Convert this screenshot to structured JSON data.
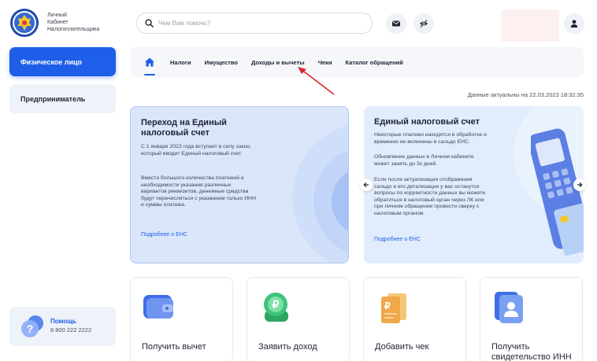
{
  "header": {
    "logo_lines": [
      "Личный",
      "Кабинет",
      "Налогоплательщика"
    ],
    "search_placeholder": "Чем Вам помочь?",
    "icons": [
      "mail-icon",
      "eye-off-icon",
      "user-icon"
    ]
  },
  "sidebar": {
    "items": [
      {
        "label": "Физическое лицо",
        "active": true
      },
      {
        "label": "Предприниматель",
        "active": false
      }
    ],
    "help": {
      "title": "Помощь",
      "phone": "8 800 222 2222"
    }
  },
  "nav": {
    "items": [
      "Налоги",
      "Имущество",
      "Доходы и вычеты",
      "Чеки",
      "Каталог обращений"
    ]
  },
  "updated_text": "Данные актуальны на 22.03.2023 18:32:35",
  "banners": [
    {
      "title": "Переход на Единый налоговый счет",
      "paragraphs": [
        "С 1 января 2023 года вступает в силу закон, который вводит Единый налоговый счет.",
        "Вместо большого количества платежей и необходимости указания различных вариантов реквизитов, денежные средства будут перечисляться с указанием только ИНН и суммы платежа."
      ],
      "link": "Подробнее о ЕНС"
    },
    {
      "title": "Единый налоговый счет",
      "paragraphs": [
        "Некоторые платежи находятся в обработке и временно не включены в сальдо ЕНС.",
        "Обновление данных в Личном кабинете может занять до 3х дней.",
        "Если после актуализации отображения сальдо и его детализации у вас останутся вопросы по корректности данных вы можете обратиться в налоговый орган через ЛК или при личном обращении провести сверку с налоговым органом."
      ],
      "link": "Подробнее о ЕНС"
    }
  ],
  "cards": [
    {
      "title": "Получить вычет",
      "icon": "wallet-icon"
    },
    {
      "title": "Заявить доход",
      "icon": "ruble-coins-icon"
    },
    {
      "title": "Добавить чек",
      "icon": "receipt-icon"
    },
    {
      "title": "Получить свидетельство ИНН",
      "icon": "id-card-icon"
    }
  ],
  "colors": {
    "accent": "#1f5ee8",
    "banner1_bg": "#dbe6fb",
    "banner2_bg": "#e1ecfc",
    "profile_block": "#fdf0f1"
  }
}
